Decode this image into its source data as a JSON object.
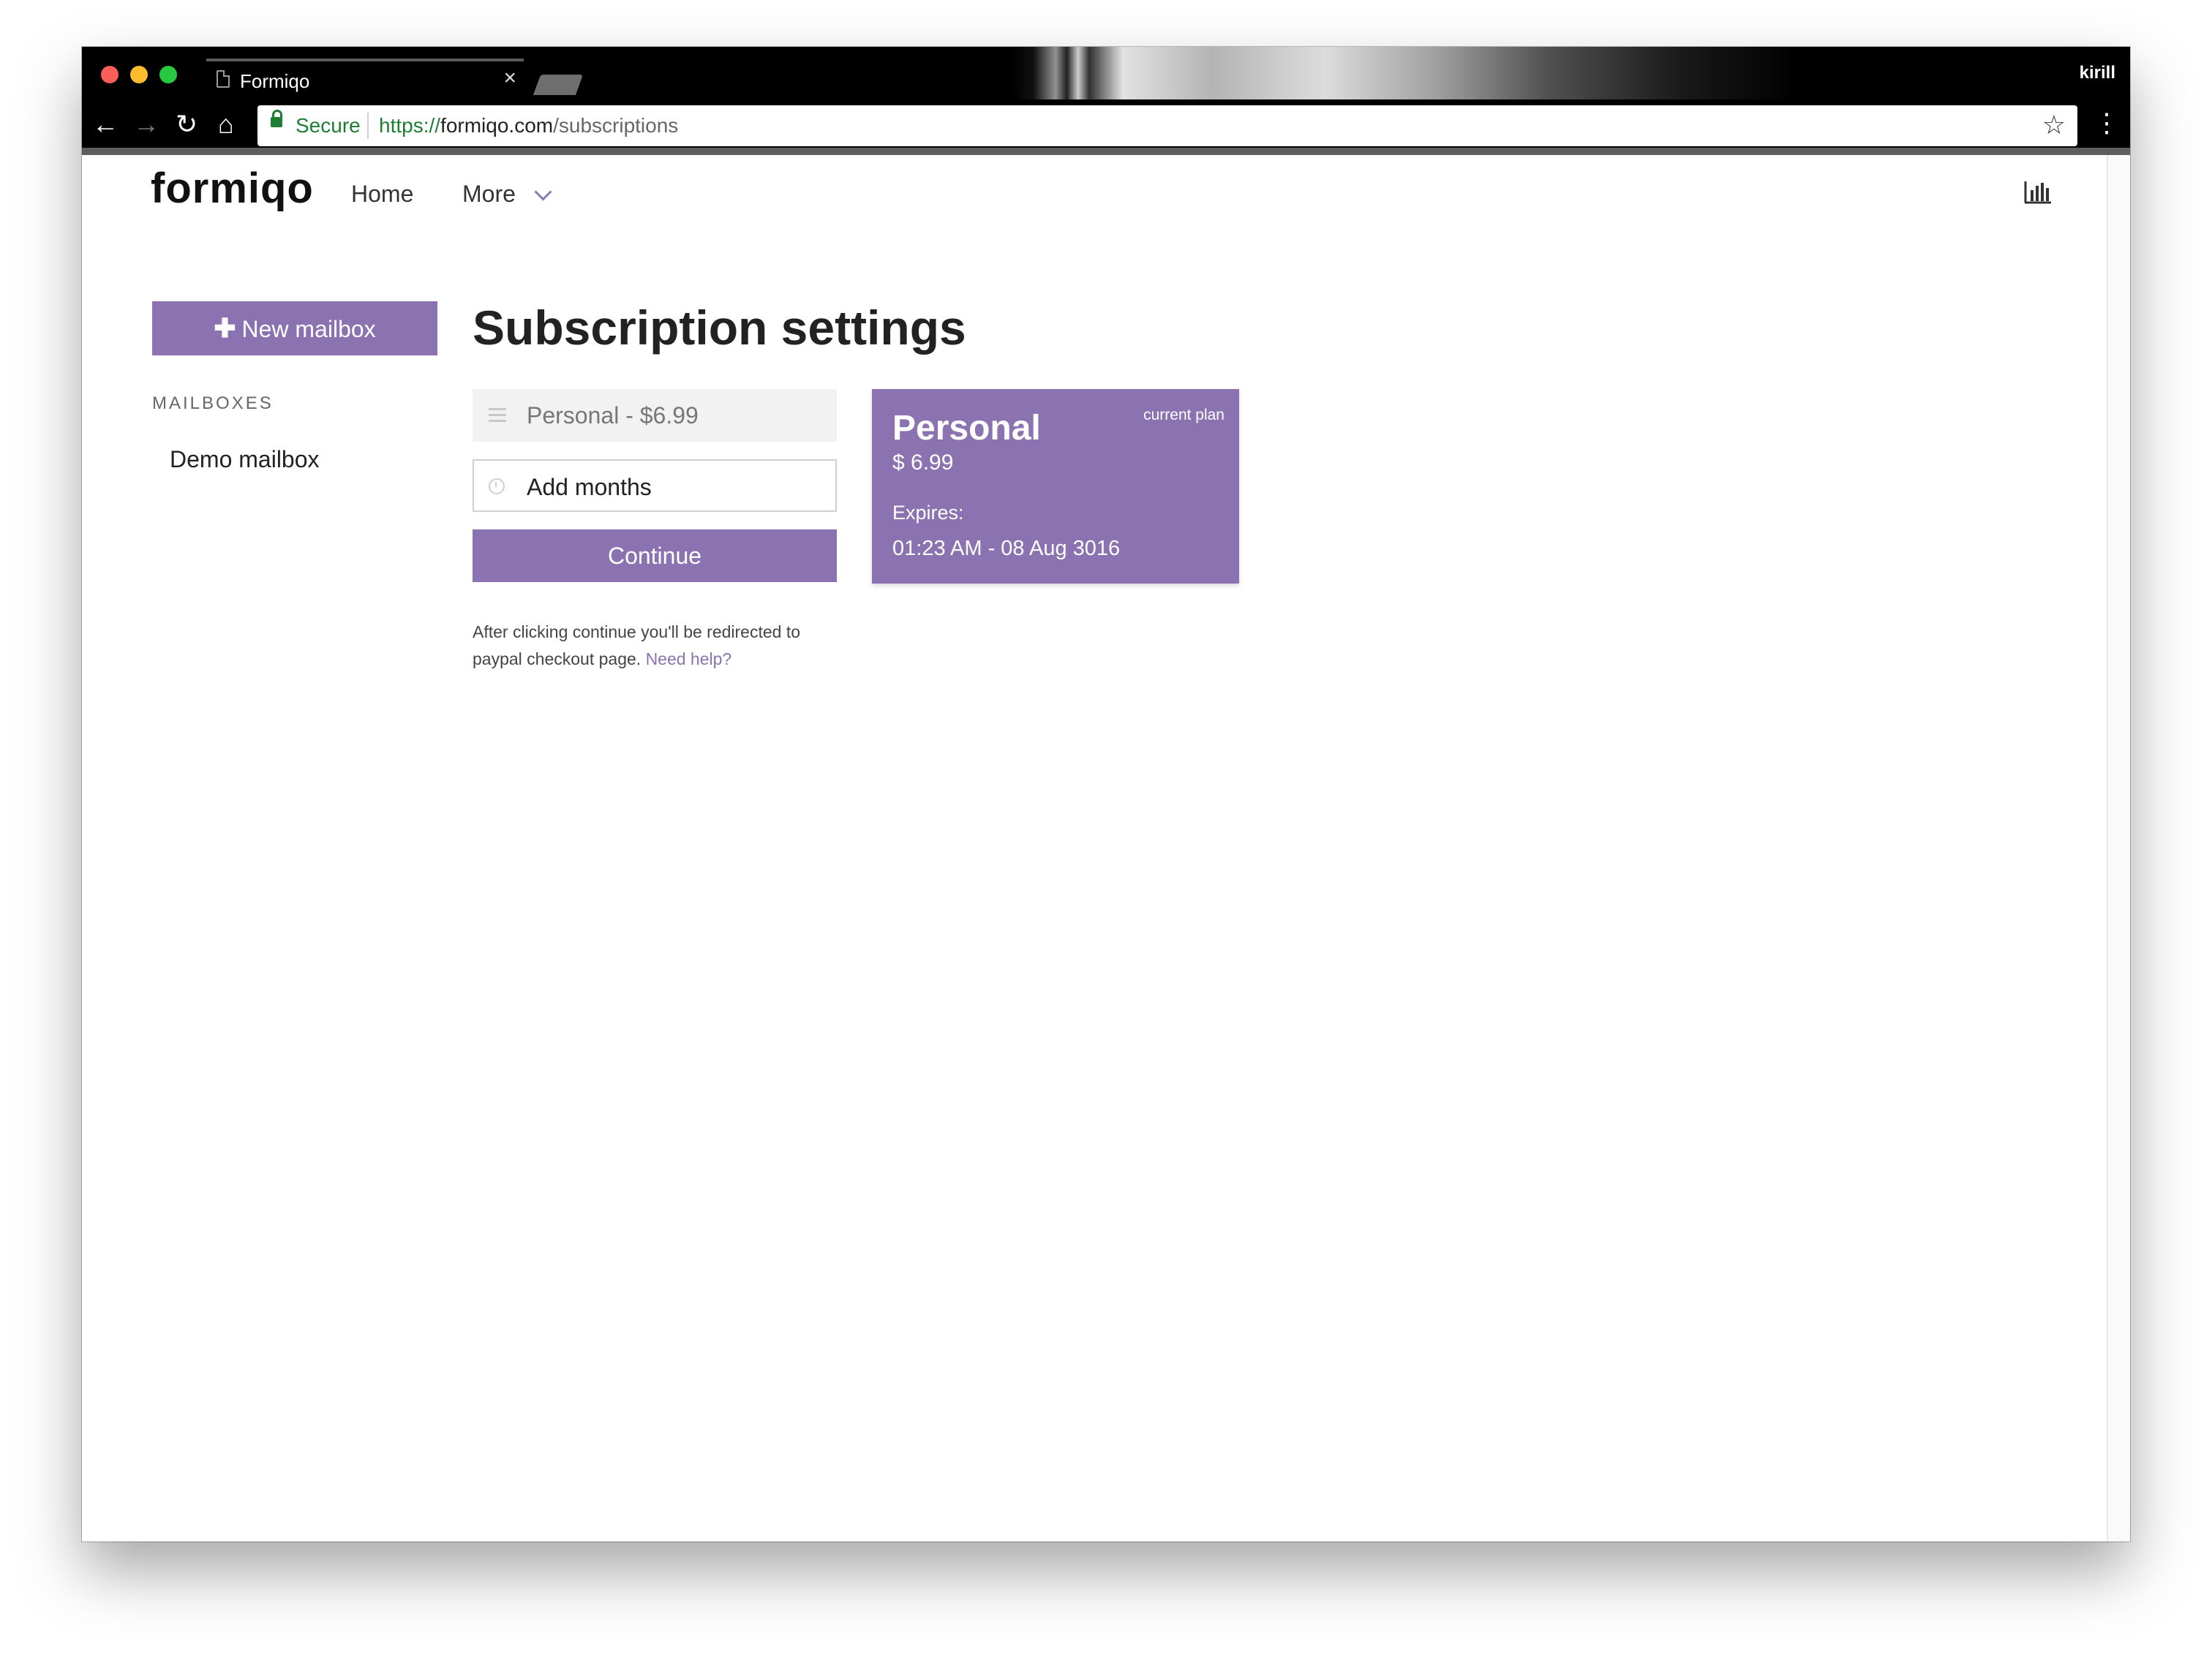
{
  "browser": {
    "tab_title": "Formiqo",
    "tab_close": "×",
    "profile_name": "kirill",
    "secure_label": "Secure",
    "url_scheme": "https://",
    "url_host": "formiqo.com",
    "url_path": "/subscriptions"
  },
  "header": {
    "logo": "formiqo",
    "nav": {
      "home": "Home",
      "more": "More"
    },
    "icons": {
      "stats": "bar-chart-icon",
      "dropdown": "chevron-down-icon"
    }
  },
  "sidebar": {
    "new_mailbox_label": "New mailbox",
    "section_label": "MAILBOXES",
    "mailboxes": [
      "Demo mailbox"
    ]
  },
  "main": {
    "title": "Subscription settings",
    "plan_select_value": "Personal - $6.99",
    "months_placeholder": "Add months",
    "continue_label": "Continue",
    "help_text": "After clicking continue you'll be redirected to paypal checkout page.",
    "help_link": "Need help?"
  },
  "current_plan": {
    "name": "Personal",
    "badge": "current plan",
    "price": "$ 6.99",
    "expires_label": "Expires:",
    "expires_value": "01:23 AM - 08 Aug 3016"
  },
  "colors": {
    "accent": "#8b72b0",
    "secure_green": "#1e7e34"
  }
}
